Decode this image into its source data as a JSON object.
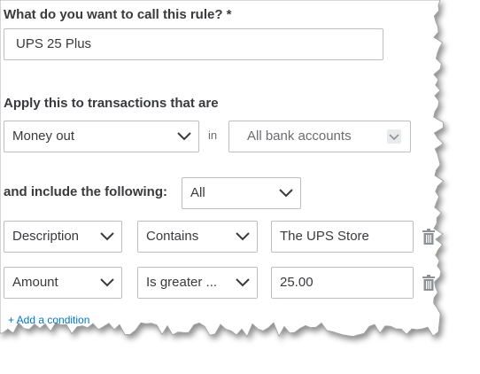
{
  "rule_name": {
    "label": "What do you want to call this rule? *",
    "value": "UPS 25 Plus"
  },
  "apply": {
    "label": "Apply this to transactions that are",
    "direction_value": "Money out",
    "in_label": "in",
    "account_value": "All bank accounts"
  },
  "include": {
    "label": "and include the following:",
    "match_value": "All"
  },
  "conditions": [
    {
      "field": "Description",
      "operator": "Contains",
      "value": "The UPS Store"
    },
    {
      "field": "Amount",
      "operator": "Is greater ...",
      "value": "25.00"
    }
  ],
  "add_condition_label": "+ Add a condition",
  "colors": {
    "link": "#0077c5",
    "border": "#babec5",
    "text": "#393a3d"
  },
  "icons": [
    "chevron-down-icon",
    "trash-icon"
  ]
}
